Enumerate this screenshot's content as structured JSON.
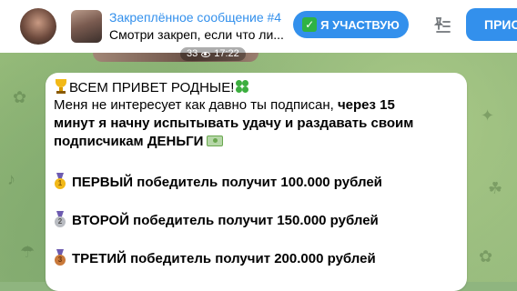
{
  "pinned": {
    "title": "Закреплённое сообщение #4",
    "preview": "Смотри закреп, если что ли...",
    "participate_label": "Я УЧАСТВУЮ",
    "join_label": "ПРИС"
  },
  "previous_message": {
    "views": "33",
    "time": "17:22"
  },
  "message": {
    "line1": "ВСЕМ ПРИВЕТ РОДНЫЕ!",
    "line2_normal": "Меня не интересует как давно ты подписан, ",
    "line2_bold": "через 15",
    "line3": "минут я начну испытывать удачу и раздавать своим",
    "line4": "подписчикам ДЕНЬГИ",
    "winners": [
      {
        "place": "ПЕРВЫЙ",
        "text": " победитель получит 100.000 рублей",
        "medal": "1"
      },
      {
        "place": "ВТОРОЙ",
        "text": " победитель получит 150.000 рублей",
        "medal": "2"
      },
      {
        "place": "ТРЕТИЙ",
        "text": " победитель получит 200.000 рублей",
        "medal": "3"
      }
    ]
  },
  "icons": {
    "trophy": "trophy-icon",
    "clover": "four-leaf-clover-icon",
    "money": "money-banknote-icon",
    "pin_list": "pinned-list-icon",
    "check": "check-mark-button-icon",
    "eye": "eye-icon"
  },
  "colors": {
    "accent": "#3390ec",
    "check_green": "#2fb344",
    "wallpaper": "#8fb57f"
  }
}
